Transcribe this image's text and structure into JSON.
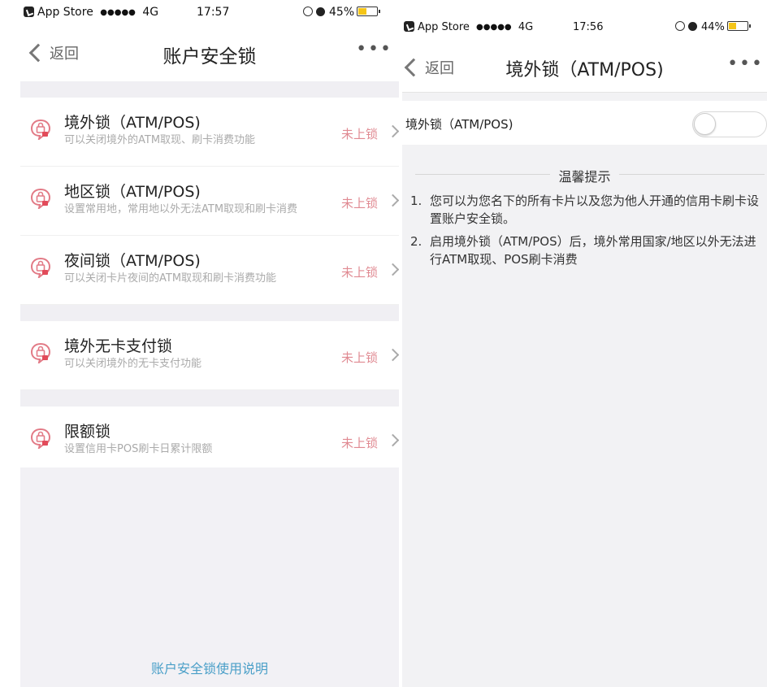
{
  "left": {
    "status": {
      "carrier": "App Store",
      "signal": "●●●●●",
      "network": "4G",
      "time": "17:57",
      "battery_text": "45%",
      "battery_level": 0.45
    },
    "nav": {
      "back_label": "返回",
      "title": "账户安全锁",
      "more_label": "•••"
    },
    "groups": [
      [
        {
          "title": "境外锁（ATM/POS)",
          "desc": "可以关闭境外的ATM取现、刷卡消费功能",
          "status": "未上锁",
          "icon": "lock-chat-icon"
        },
        {
          "title": "地区锁（ATM/POS)",
          "desc": "设置常用地，常用地以外无法ATM取现和刷卡消费",
          "status": "未上锁",
          "icon": "lock-chat-icon"
        },
        {
          "title": "夜间锁（ATM/POS)",
          "desc": "可以关闭卡片夜间的ATM取现和刷卡消费功能",
          "status": "未上锁",
          "icon": "lock-chat-icon"
        }
      ],
      [
        {
          "title": "境外无卡支付锁",
          "desc": "可以关闭境外的无卡支付功能",
          "status": "未上锁",
          "icon": "lock-chat-icon"
        }
      ],
      [
        {
          "title": "限额锁",
          "desc": "设置信用卡POS刷卡日累计限额",
          "status": "未上锁",
          "icon": "lock-chat-icon"
        }
      ]
    ],
    "footer_link": "账户安全锁使用说明"
  },
  "right": {
    "status": {
      "carrier": "App Store",
      "signal": "●●●●●",
      "network": "4G",
      "time": "17:56",
      "battery_text": "44%",
      "battery_level": 0.44
    },
    "nav": {
      "back_label": "返回",
      "title": "境外锁（ATM/POS)",
      "more_label": "•••"
    },
    "toggle": {
      "label": "境外锁（ATM/POS)",
      "on": false
    },
    "tips": {
      "title": "温馨提示",
      "items": [
        {
          "num": "1.",
          "text": "您可以为您名下的所有卡片以及您为他人开通的信用卡刷卡设置账户安全锁。"
        },
        {
          "num": "2.",
          "text": "启用境外锁（ATM/POS）后，境外常用国家/地区以外无法进行ATM取现、POS刷卡消费"
        }
      ]
    }
  },
  "colors": {
    "accent_red": "#e08a92",
    "link_blue": "#4a9fc8",
    "battery_yellow": "#f5c518"
  }
}
